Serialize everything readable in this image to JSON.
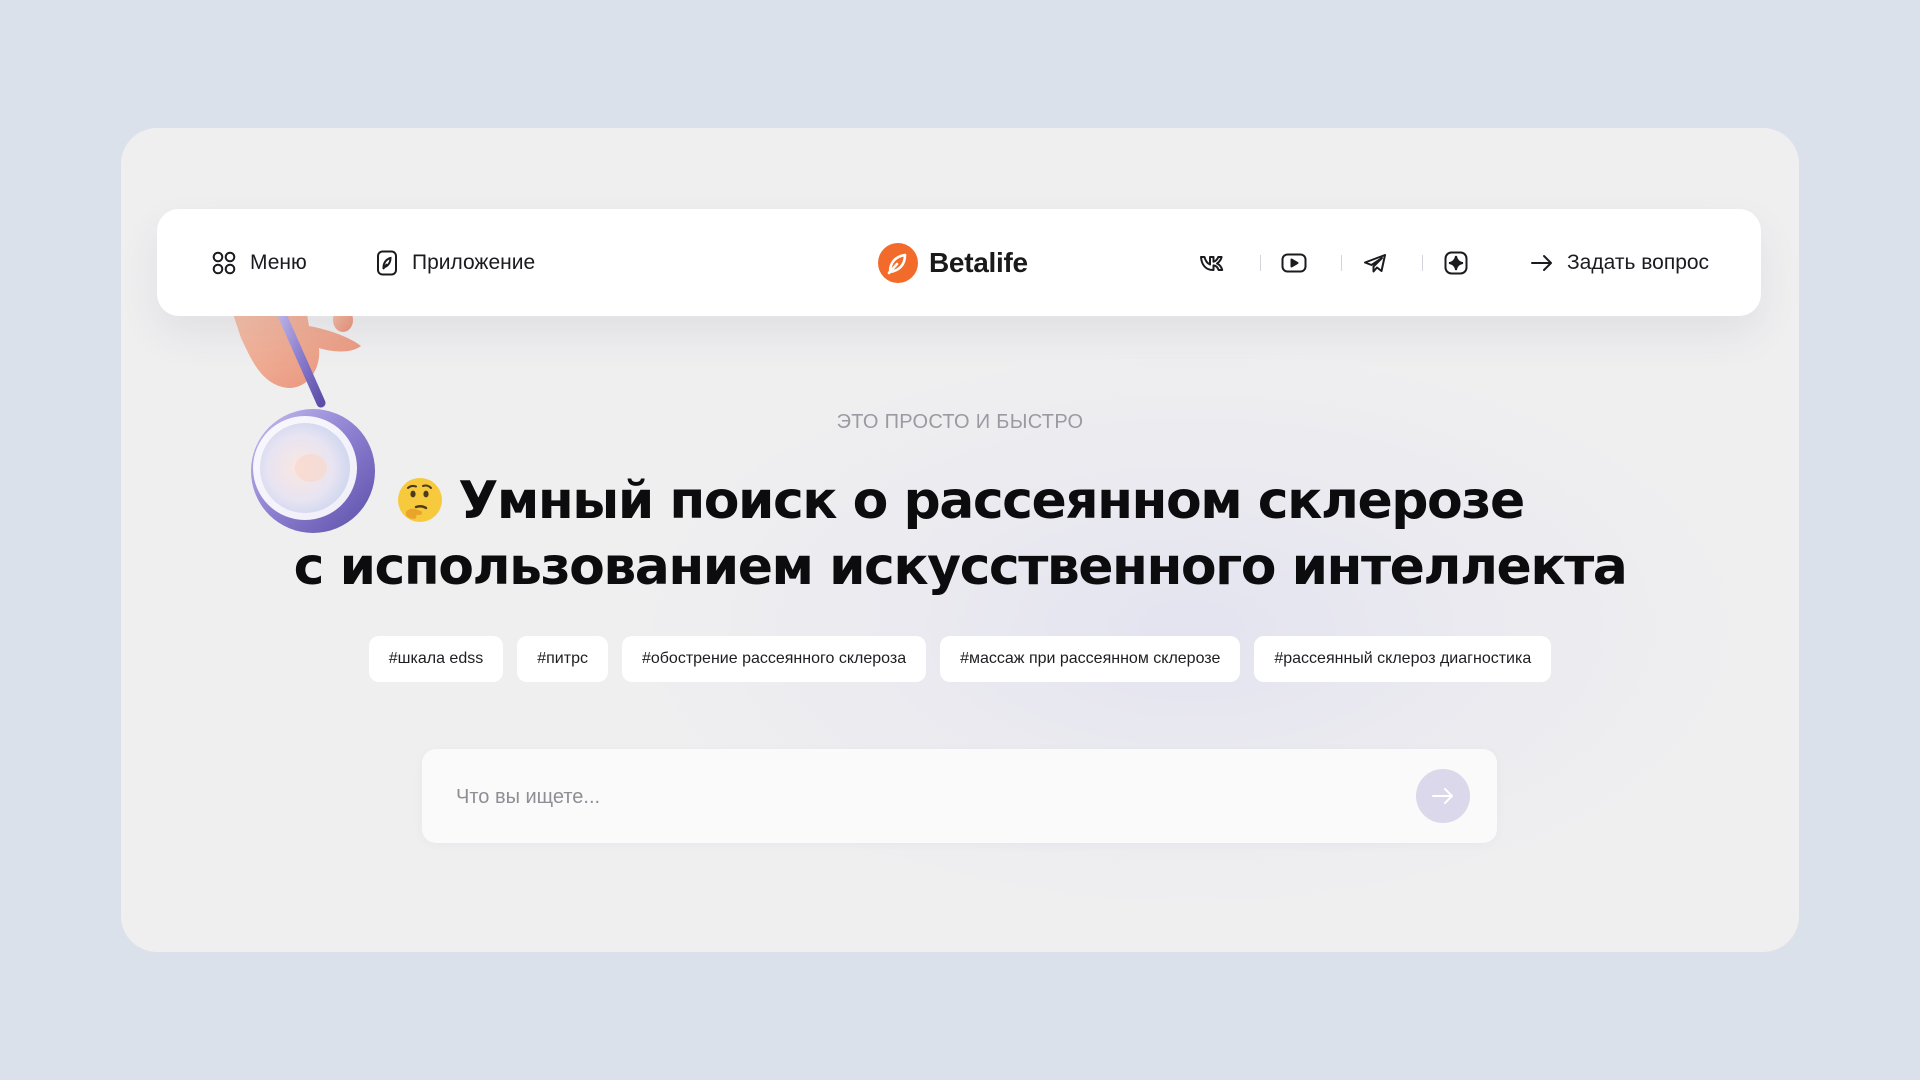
{
  "nav": {
    "menu_label": "Меню",
    "app_label": "Приложение",
    "logo_text": "Betalife",
    "ask_label": "Задать вопрос",
    "social_icons": [
      "vk-icon",
      "youtube-icon",
      "telegram-icon",
      "dzen-icon"
    ]
  },
  "hero": {
    "eyebrow": "ЭТО ПРОСТО И БЫСТРО",
    "emoji": "thinking-face-icon",
    "headline_line1": "Умный поиск о рассеянном склерозе",
    "headline_line2": "с использованием искусственного интеллекта"
  },
  "tags": [
    "#шкала edss",
    "#питрс",
    "#обострение рассеянного склероза",
    "#массаж при рассеянном склерозе",
    "#рассеянный склероз диагностика"
  ],
  "search": {
    "placeholder": "Что вы ищете...",
    "value": ""
  },
  "colors": {
    "page_bg": "#dbe1ea",
    "card_bg": "#efeff0",
    "brand_orange": "#f26b2a",
    "search_button": "#dad8ea"
  }
}
